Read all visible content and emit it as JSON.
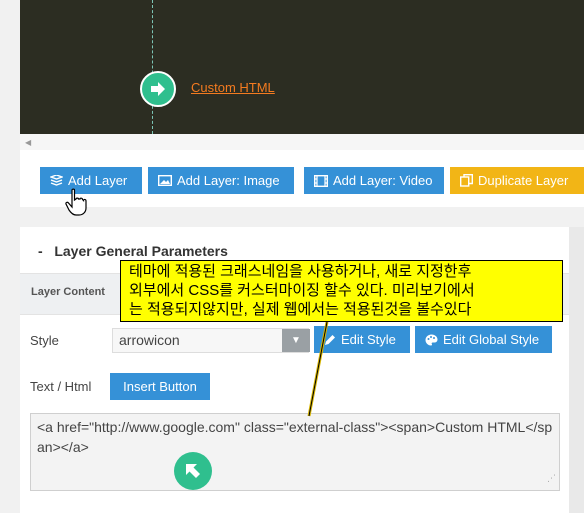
{
  "canvas": {
    "link_text": "Custom HTML"
  },
  "toolbar": {
    "buttons": [
      {
        "label": "Add Layer",
        "icon": "layers-icon"
      },
      {
        "label": "Add Layer: Image",
        "icon": "image-icon"
      },
      {
        "label": "Add Layer: Video",
        "icon": "film-icon"
      },
      {
        "label": "Duplicate Layer",
        "icon": "duplicate-icon"
      }
    ]
  },
  "panel": {
    "collapse_marker": "-",
    "title": "Layer General Parameters",
    "subtab": "Layer Content",
    "style_label": "Style",
    "style_value": "arrowicon",
    "edit_style": "Edit Style",
    "edit_global_style": "Edit Global Style",
    "text_html_label": "Text / Html",
    "insert_button": "Insert Button",
    "code": "<a href=\"http://www.google.com\" class=\"external-class\"><span>Custom HTML</span></a>"
  },
  "callout": {
    "lines": [
      "테마에 적용된 크래스네임을 사용하거나, 새로 지정한후",
      "외부에서 CSS를 커스터마이징 할수 있다. 미리보기에서",
      "는 적용되지않지만, 실제 웹에서는 적용된것을 볼수있다"
    ]
  },
  "colors": {
    "accent_blue": "#3591d7",
    "accent_yellow": "#f2b516",
    "accent_green": "#2fbf8e",
    "link_orange": "#f47b20",
    "canvas_bg": "#2c2d22"
  }
}
